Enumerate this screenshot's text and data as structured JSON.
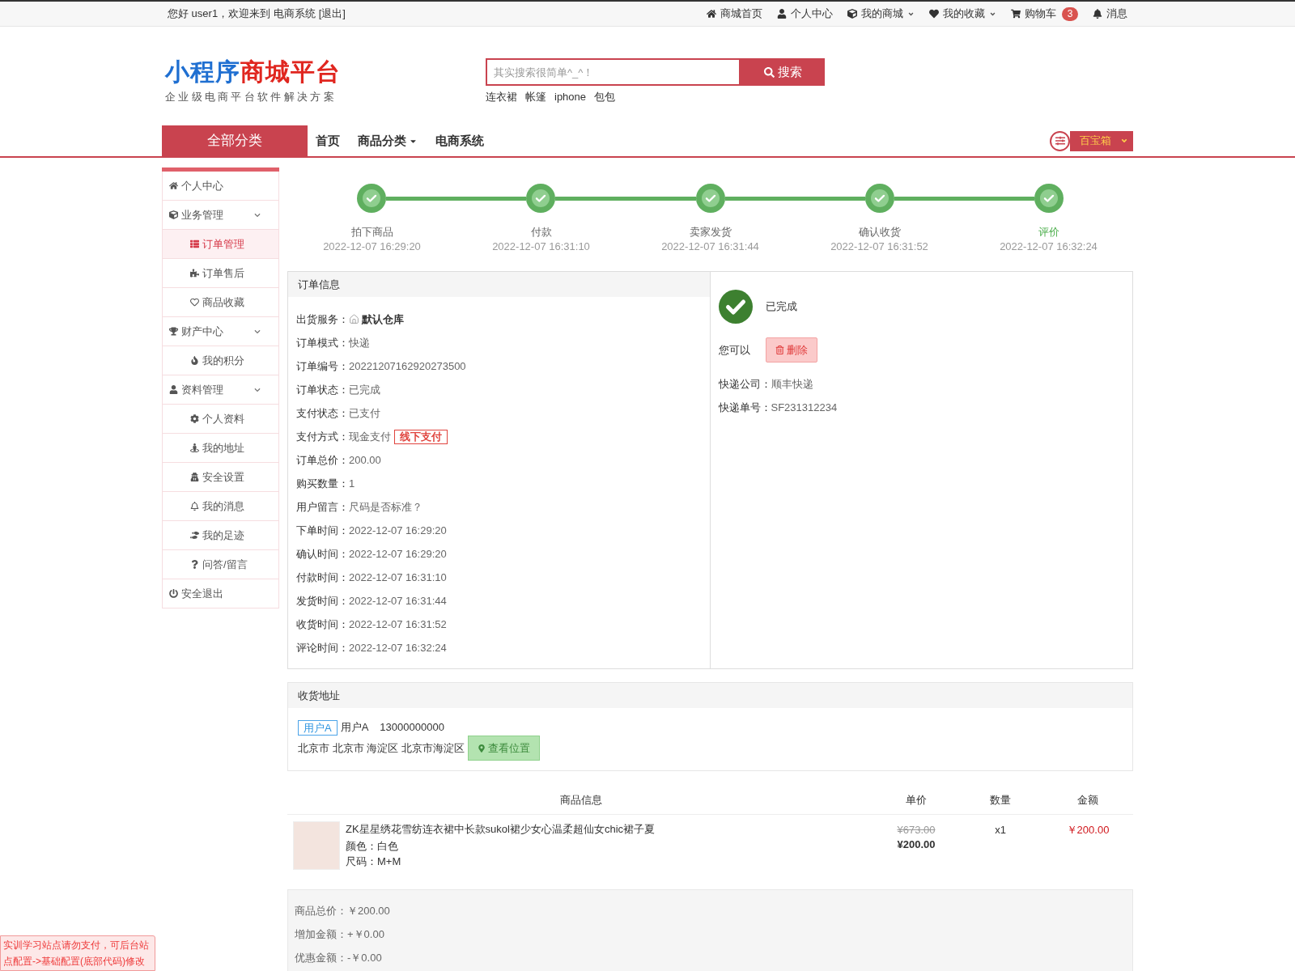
{
  "top_bar": {
    "greeting": "您好 user1，欢迎来到 电商系统",
    "logout": "[退出]",
    "links": [
      {
        "label": "商城首页",
        "dropdown": false
      },
      {
        "label": "个人中心",
        "dropdown": false
      },
      {
        "label": "我的商城",
        "dropdown": true
      },
      {
        "label": "我的收藏",
        "dropdown": true
      },
      {
        "label": "购物车",
        "dropdown": false,
        "badge": "3"
      },
      {
        "label": "消息",
        "dropdown": false
      }
    ]
  },
  "header": {
    "logo": {
      "parts": [
        {
          "text": "小程序",
          "color": "#1f6fd1"
        },
        {
          "text": "商城平台",
          "color": "#e0261f"
        }
      ],
      "slogan": "企业级电商平台软件解决方案"
    },
    "search": {
      "placeholder": "其实搜索很简单^_^！",
      "button": "搜索",
      "hot_keywords": [
        "连衣裙",
        "帐篷",
        "iphone",
        "包包"
      ]
    }
  },
  "nav": {
    "category_button": "全部分类",
    "links": [
      {
        "label": "首页",
        "dropdown": false
      },
      {
        "label": "商品分类",
        "dropdown": true
      },
      {
        "label": "电商系统",
        "dropdown": false
      }
    ],
    "toolbox": "百宝箱"
  },
  "sidebar": {
    "items": [
      {
        "label": "个人中心",
        "selected": false
      },
      {
        "label": "业务管理",
        "selected": false,
        "expanded": true,
        "children": [
          {
            "label": "订单管理",
            "selected": true
          },
          {
            "label": "订单售后",
            "selected": false
          },
          {
            "label": "商品收藏",
            "selected": false
          }
        ]
      },
      {
        "label": "财产中心",
        "selected": false,
        "expanded": true,
        "children": [
          {
            "label": "我的积分",
            "selected": false
          }
        ]
      },
      {
        "label": "资料管理",
        "selected": false,
        "expanded": true,
        "children": [
          {
            "label": "个人资料",
            "selected": false
          },
          {
            "label": "我的地址",
            "selected": false
          },
          {
            "label": "安全设置",
            "selected": false
          },
          {
            "label": "我的消息",
            "selected": false
          },
          {
            "label": "我的足迹",
            "selected": false
          },
          {
            "label": "问答/留言",
            "selected": false
          }
        ]
      },
      {
        "label": "安全退出",
        "selected": false
      }
    ]
  },
  "steps": [
    {
      "label": "拍下商品",
      "time": "2022-12-07 16:29:20",
      "done": true,
      "current": false
    },
    {
      "label": "付款",
      "time": "2022-12-07 16:31:10",
      "done": true,
      "current": false
    },
    {
      "label": "卖家发货",
      "time": "2022-12-07 16:31:44",
      "done": true,
      "current": false
    },
    {
      "label": "确认收货",
      "time": "2022-12-07 16:31:52",
      "done": true,
      "current": false
    },
    {
      "label": "评价",
      "time": "2022-12-07 16:32:24",
      "done": true,
      "current": true
    }
  ],
  "order_info": {
    "title": "订单信息",
    "rows": [
      {
        "kind": "warehouse",
        "label": "出货服务：",
        "value": "默认仓库"
      },
      {
        "kind": "text",
        "label": "订单模式：",
        "value": "快递"
      },
      {
        "kind": "text",
        "label": "订单编号：",
        "value": "20221207162920273500"
      },
      {
        "kind": "text",
        "label": "订单状态：",
        "value": "已完成"
      },
      {
        "kind": "text",
        "label": "支付状态：",
        "value": "已支付"
      },
      {
        "kind": "tagged",
        "label": "支付方式：",
        "value": "现金支付",
        "tag": "线下支付"
      },
      {
        "kind": "text",
        "label": "订单总价：",
        "value": "200.00"
      },
      {
        "kind": "text",
        "label": "购买数量：",
        "value": "1"
      },
      {
        "kind": "text",
        "label": "用户留言：",
        "value": "尺码是否标准？"
      },
      {
        "kind": "text",
        "label": "下单时间：",
        "value": "2022-12-07 16:29:20"
      },
      {
        "kind": "text",
        "label": "确认时间：",
        "value": "2022-12-07 16:29:20"
      },
      {
        "kind": "text",
        "label": "付款时间：",
        "value": "2022-12-07 16:31:10"
      },
      {
        "kind": "text",
        "label": "发货时间：",
        "value": "2022-12-07 16:31:44"
      },
      {
        "kind": "text",
        "label": "收货时间：",
        "value": "2022-12-07 16:31:52"
      },
      {
        "kind": "text",
        "label": "评论时间：",
        "value": "2022-12-07 16:32:24"
      }
    ]
  },
  "order_status": {
    "status": "已完成",
    "actions_label": "您可以",
    "delete_button": "删除",
    "rows": [
      {
        "label": "快递公司：",
        "value": "顺丰快递"
      },
      {
        "label": "快递单号：",
        "value": "SF231312234"
      }
    ]
  },
  "address": {
    "title": "收货地址",
    "tag": "用户A",
    "name": "用户A",
    "phone": "13000000000",
    "address": "北京市 北京市 海淀区 北京市海淀区",
    "map_button": "查看位置"
  },
  "products": {
    "columns": [
      "商品信息",
      "单价",
      "数量",
      "金额"
    ],
    "rows": [
      {
        "name": "ZK星星绣花雪纺连衣裙中长款sukol裙少女心温柔超仙女chic裙子夏",
        "specs": [
          "颜色：白色",
          "尺码：M+M"
        ],
        "original_price": "¥673.00",
        "price": "¥200.00",
        "quantity": "x1",
        "amount": "￥200.00"
      }
    ]
  },
  "summary": {
    "rows": [
      {
        "label": "商品总价：",
        "value": "￥200.00"
      },
      {
        "label": "增加金额：",
        "value": "+￥0.00"
      },
      {
        "label": "优惠金额：",
        "value": "-￥0.00"
      }
    ]
  },
  "notice": "实训学习站点请勿支付，可后台站点配置->基础配置(底部代码)修改"
}
